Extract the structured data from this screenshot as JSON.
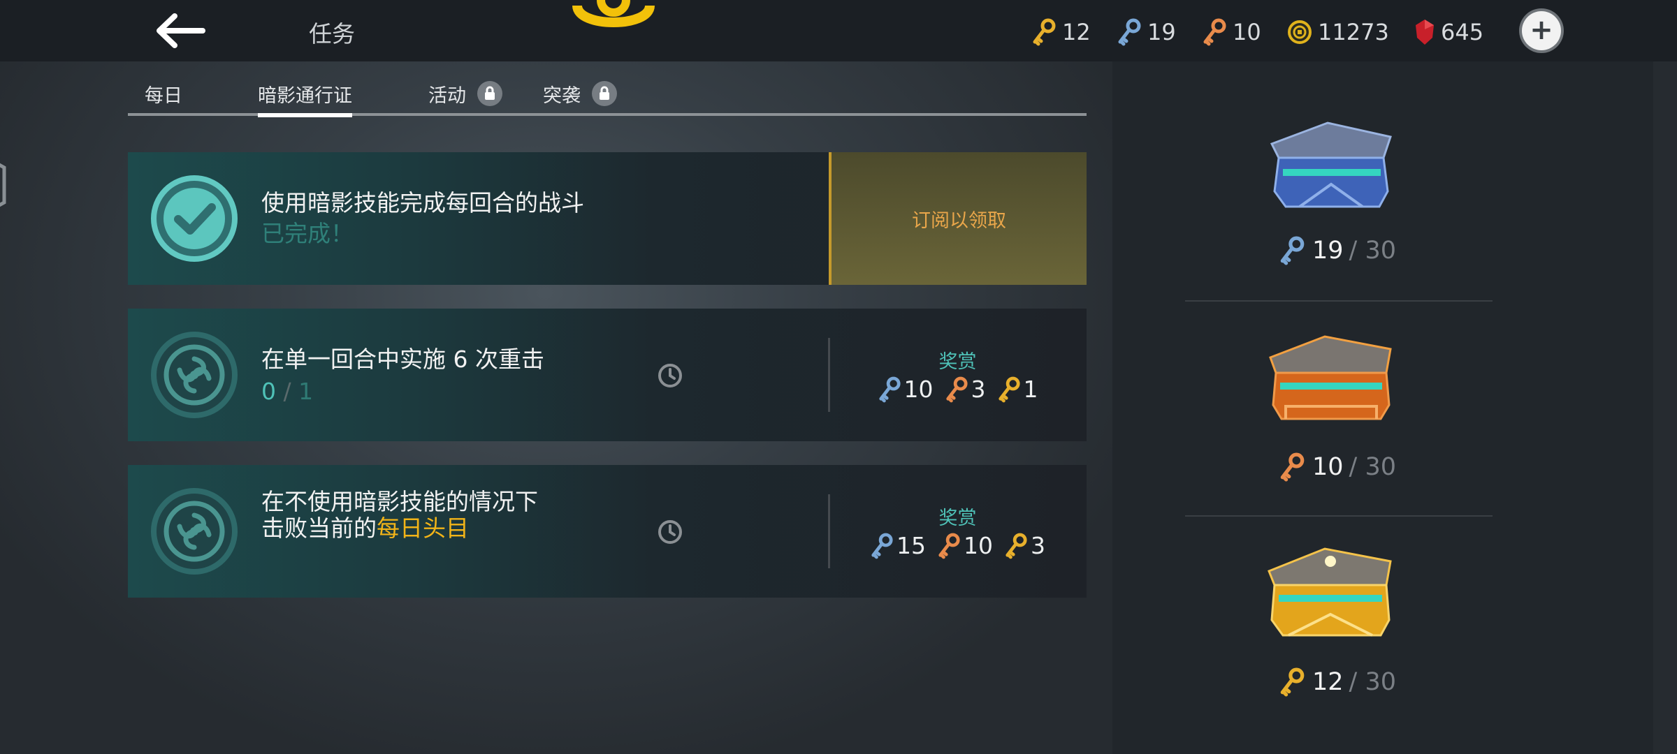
{
  "header": {
    "title": "任务",
    "currencies": [
      {
        "icon": "gold-key-icon",
        "value": "12",
        "color": "#e8b02c"
      },
      {
        "icon": "blue-key-icon",
        "value": "19",
        "color": "#7aa7d6"
      },
      {
        "icon": "orange-key-icon",
        "value": "10",
        "color": "#e98b4b"
      },
      {
        "icon": "coin-icon",
        "value": "11273",
        "color": "#e0b21c"
      },
      {
        "icon": "ruby-icon",
        "value": "645",
        "color": "#d9242a"
      }
    ]
  },
  "tabs": [
    {
      "label": "每日",
      "active": false,
      "locked": false
    },
    {
      "label": "暗影通行证",
      "active": true,
      "locked": false
    },
    {
      "label": "活动",
      "active": false,
      "locked": true
    },
    {
      "label": "突袭",
      "active": false,
      "locked": true
    }
  ],
  "quests": [
    {
      "title": "使用暗影技能完成每回合的战斗",
      "status": "已完成！",
      "claim_label": "订阅以领取"
    },
    {
      "title": "在单一回合中实施 6 次重击",
      "progress_current": "0",
      "progress_sep": "/",
      "progress_total": "1",
      "reward_label": "奖赏",
      "rewards": [
        {
          "icon": "blue-key-icon",
          "value": "10"
        },
        {
          "icon": "orange-key-icon",
          "value": "3"
        },
        {
          "icon": "gold-key-icon",
          "value": "1"
        }
      ]
    },
    {
      "title_line1": "在不使用暗影技能的情况下",
      "title_line2_prefix": "击败当前的",
      "title_line2_highlight": "每日头目",
      "reward_label": "奖赏",
      "rewards": [
        {
          "icon": "blue-key-icon",
          "value": "15"
        },
        {
          "icon": "orange-key-icon",
          "value": "10"
        },
        {
          "icon": "gold-key-icon",
          "value": "3"
        }
      ]
    }
  ],
  "chests": [
    {
      "name": "blue-chest",
      "key_icon": "blue-key-icon",
      "current": "19",
      "total": "/ 30"
    },
    {
      "name": "orange-chest",
      "key_icon": "orange-key-icon",
      "current": "10",
      "total": "/ 30"
    },
    {
      "name": "gold-chest",
      "key_icon": "gold-key-icon",
      "current": "12",
      "total": "/ 30"
    }
  ],
  "colors": {
    "accent_teal": "#4fc2b8",
    "highlight_yellow": "#f2b418",
    "claim_orange": "#e9a64a"
  }
}
